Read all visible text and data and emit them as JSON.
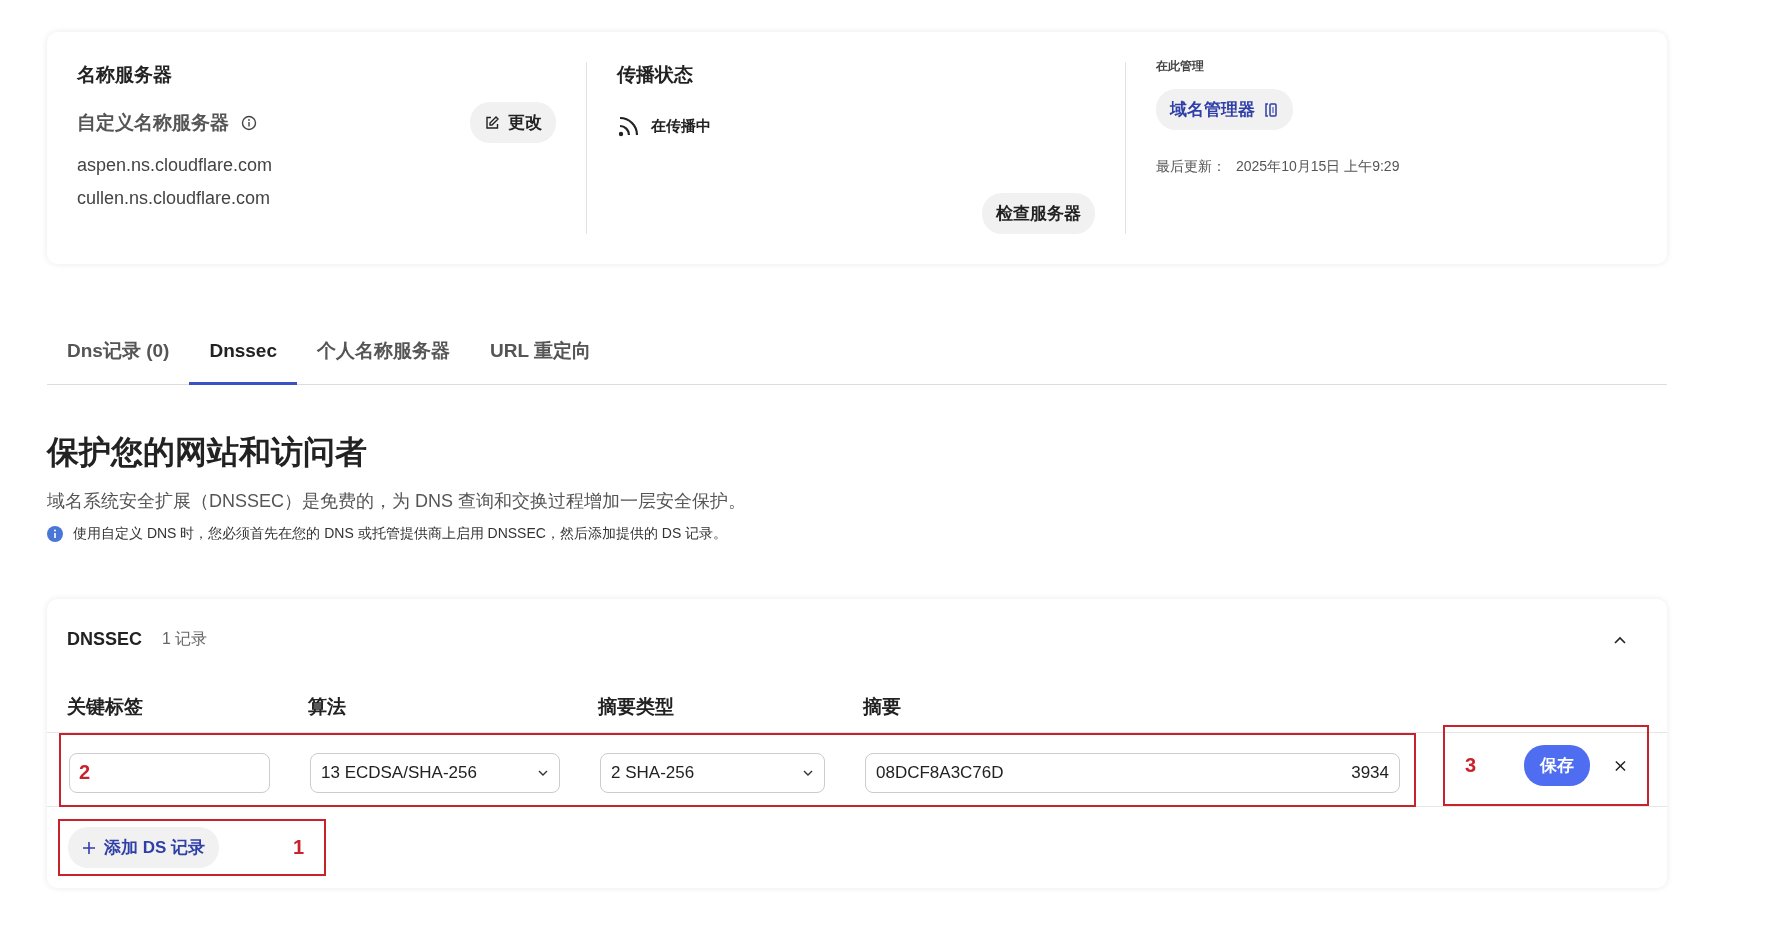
{
  "nameservers": {
    "title": "名称服务器",
    "subtitle": "自定义名称服务器",
    "change_button": "更改",
    "servers": [
      "aspen.ns.cloudflare.com",
      "cullen.ns.cloudflare.com"
    ]
  },
  "propagation": {
    "title": "传播状态",
    "status": "在传播中",
    "check_button": "检查服务器"
  },
  "management": {
    "label": "在此管理",
    "link": "域名管理器",
    "updated_label": "最后更新：",
    "updated_value": "2025年10月15日 上午9:29"
  },
  "tabs": [
    {
      "label": "Dns记录 (0)",
      "selected": false
    },
    {
      "label": "Dnssec",
      "selected": true
    },
    {
      "label": "个人名称服务器",
      "selected": false
    },
    {
      "label": "URL 重定向",
      "selected": false
    }
  ],
  "heading": "保护您的网站和访问者",
  "description": "域名系统安全扩展（DNSSEC）是免费的，为 DNS 查询和交换过程增加一层安全保护。",
  "info": "使用自定义 DNS 时，您必须首先在您的 DNS 或托管提供商上启用 DNSSEC，然后添加提供的 DS 记录。",
  "dnssec": {
    "title": "DNSSEC",
    "count": "1 记录",
    "expanded": true,
    "columns": [
      "关键标签",
      "算法",
      "摘要类型",
      "摘要"
    ],
    "row": {
      "algorithm": "13 ECDSA/SHA-256",
      "digest_type": "2 SHA-256",
      "digest_start": "08DCF8A3C76D",
      "digest_end": "3934",
      "save": "保存"
    },
    "add_button": "添加 DS 记录"
  },
  "annotations": [
    {
      "label": "1"
    },
    {
      "label": "2"
    },
    {
      "label": "3"
    }
  ]
}
